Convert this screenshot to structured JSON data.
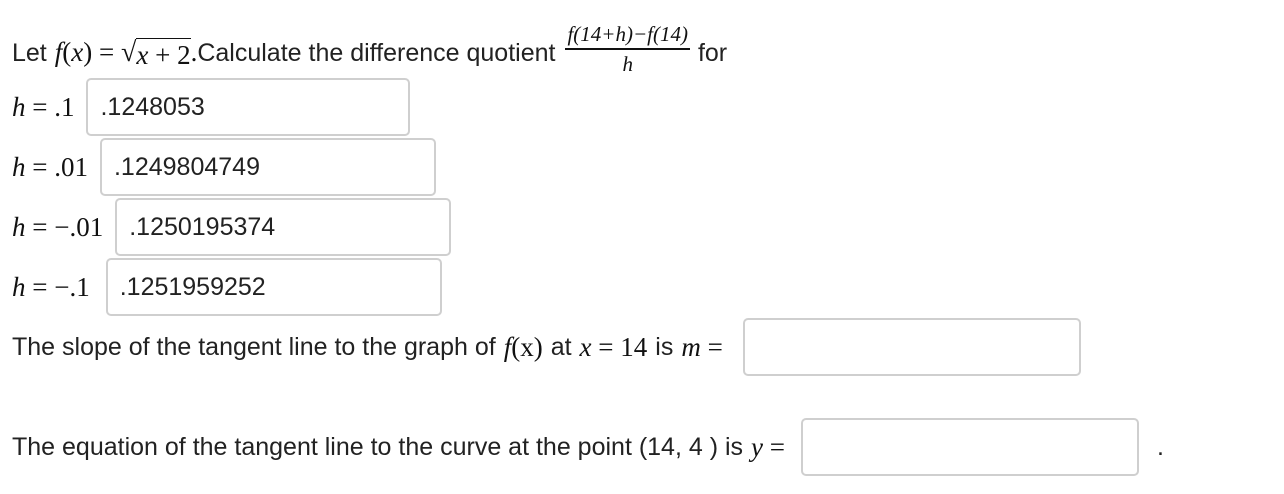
{
  "intro": {
    "let": "Let",
    "f": "f",
    "lparen": "(",
    "x": "x",
    "rparen_eq": ") =",
    "sqrt_sign": "√",
    "radicand_x": "x",
    "radicand_rest": " + 2",
    "period": ".",
    "calc": " Calculate the difference quotient",
    "frac_num": "f(14+h)−f(14)",
    "frac_den": "h",
    "for": "for"
  },
  "rows": [
    {
      "h_label": "h",
      "eq": " = .1",
      "value": ".1248053"
    },
    {
      "h_label": "h",
      "eq": " = .01",
      "value": ".1249804749"
    },
    {
      "h_label": "h",
      "eq": " = −.01",
      "value": ".1250195374"
    },
    {
      "h_label": "h",
      "eq": " = −.1",
      "value": ".1251959252"
    }
  ],
  "slope": {
    "text": "The slope of the tangent line to the graph of",
    "f": "f",
    "arg": "(x)",
    "at": "at",
    "x": "x",
    "eq_val": " = 14",
    "is": "is",
    "m": "m",
    "eq": " =",
    "value": ""
  },
  "tangent": {
    "text": "The equation of the tangent line to the curve at the point (14, 4 ) is",
    "y": "y",
    "eq": " =",
    "value": "",
    "period": "."
  }
}
